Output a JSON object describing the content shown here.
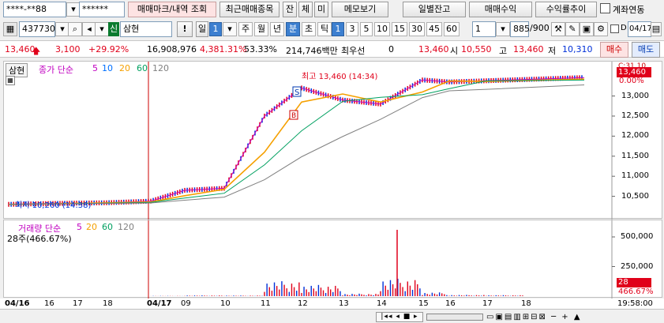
{
  "toolbar1": {
    "account": "****-**88",
    "password": "******",
    "btn_mark": "매매마크/내역 조회",
    "btn_recent": "최근매매종목",
    "btn_jan": "잔",
    "btn_che": "체",
    "btn_mi": "미",
    "btn_memo": "메모보기",
    "btn_daily": "일별잔고",
    "btn_profit": "매매수익",
    "btn_trend": "수익률추이",
    "chk_link": "계좌연동"
  },
  "toolbar2": {
    "code": "437730",
    "badge": "신",
    "name": "삼현",
    "period_day": "일",
    "period_num": "1",
    "periods": [
      "주",
      "월",
      "년",
      "분",
      "초",
      "틱"
    ],
    "active_period": "분",
    "minute_opts": [
      "1",
      "3",
      "5",
      "10",
      "15",
      "30",
      "45",
      "60"
    ],
    "active_minute": "1",
    "minute_sel": "1",
    "count": "885",
    "count_total": "/900",
    "chk_d": "D",
    "date": "04/17"
  },
  "quote": {
    "price": "13,460",
    "change": "3,100",
    "change_pct": "+29.92%",
    "volume": "16,908,976",
    "vol_ratio": "4,381.31%",
    "strength": "53.33%",
    "amount": "214,746백만",
    "label_priority": "최우선",
    "priority_val": "0",
    "ask_price": "13,460",
    "label_open": "시",
    "open": "10,550",
    "label_high": "고",
    "high": "13,460",
    "label_low": "저",
    "low": "10,310",
    "btn_buy": "매수",
    "btn_sell": "매도"
  },
  "price_pane": {
    "stock_tab": "삼현",
    "legend_title": "종가 단순",
    "ma_periods": [
      "5",
      "10",
      "20",
      "60",
      "120"
    ],
    "high_marker": "최고 13,460 (14:34)",
    "low_marker": "최저 10,260 (14:38)",
    "current_tag": "13,460",
    "current_pct": "0.00%",
    "top_partial": "C:31.10",
    "signal_s": "S",
    "signal_b": "B"
  },
  "volume_pane": {
    "legend_title": "거래량 단순",
    "ma_periods": [
      "5",
      "20",
      "60",
      "120"
    ],
    "sub_label": "28주(466.67%)",
    "current_tag": "28",
    "current_pct": "466.67%"
  },
  "time_axis": {
    "labels": [
      "04/16",
      "16",
      "17",
      "18",
      "04/17",
      "09",
      "10",
      "11",
      "12",
      "13",
      "14",
      "15",
      "16",
      "17",
      "18"
    ],
    "clock": "19:58:00"
  },
  "colors": {
    "up": "#e0001a",
    "down": "#0030d8",
    "ma5": "#c000c0",
    "ma10": "#0070ff",
    "ma20": "#f5a000",
    "ma60": "#00a060",
    "ma120": "#808080"
  },
  "chart_data": [
    {
      "type": "line",
      "series_kind": "candlestick",
      "ylim": [
        10000,
        13700
      ],
      "y_ticks": [
        10500,
        11000,
        11500,
        12000,
        12500,
        13000
      ],
      "x_categories": [
        "04/16",
        "16",
        "17",
        "18",
        "04/17",
        "09",
        "10",
        "11",
        "12",
        "13",
        "14",
        "15",
        "16",
        "17",
        "18"
      ],
      "series": [
        {
          "name": "종가",
          "values": [
            10300,
            10320,
            10330,
            10340,
            10380,
            10650,
            10700,
            12500,
            13200,
            12900,
            12800,
            13400,
            13350,
            13380,
            13460
          ]
        }
      ],
      "annotations": [
        "최고 13,460 (14:34)",
        "최저 10,260 (14:38)"
      ]
    },
    {
      "type": "bar",
      "ylim": [
        0,
        600000
      ],
      "y_ticks": [
        250000,
        500000
      ],
      "x_categories": [
        "04/16",
        "16",
        "17",
        "18",
        "04/17",
        "09",
        "10",
        "11",
        "12",
        "13",
        "14",
        "15",
        "16",
        "17",
        "18"
      ],
      "series": [
        {
          "name": "거래량",
          "values": [
            0,
            0,
            0,
            0,
            2000,
            6000,
            5000,
            120000,
            90000,
            20000,
            140000,
            30000,
            10000,
            8000,
            5000
          ]
        }
      ]
    }
  ]
}
